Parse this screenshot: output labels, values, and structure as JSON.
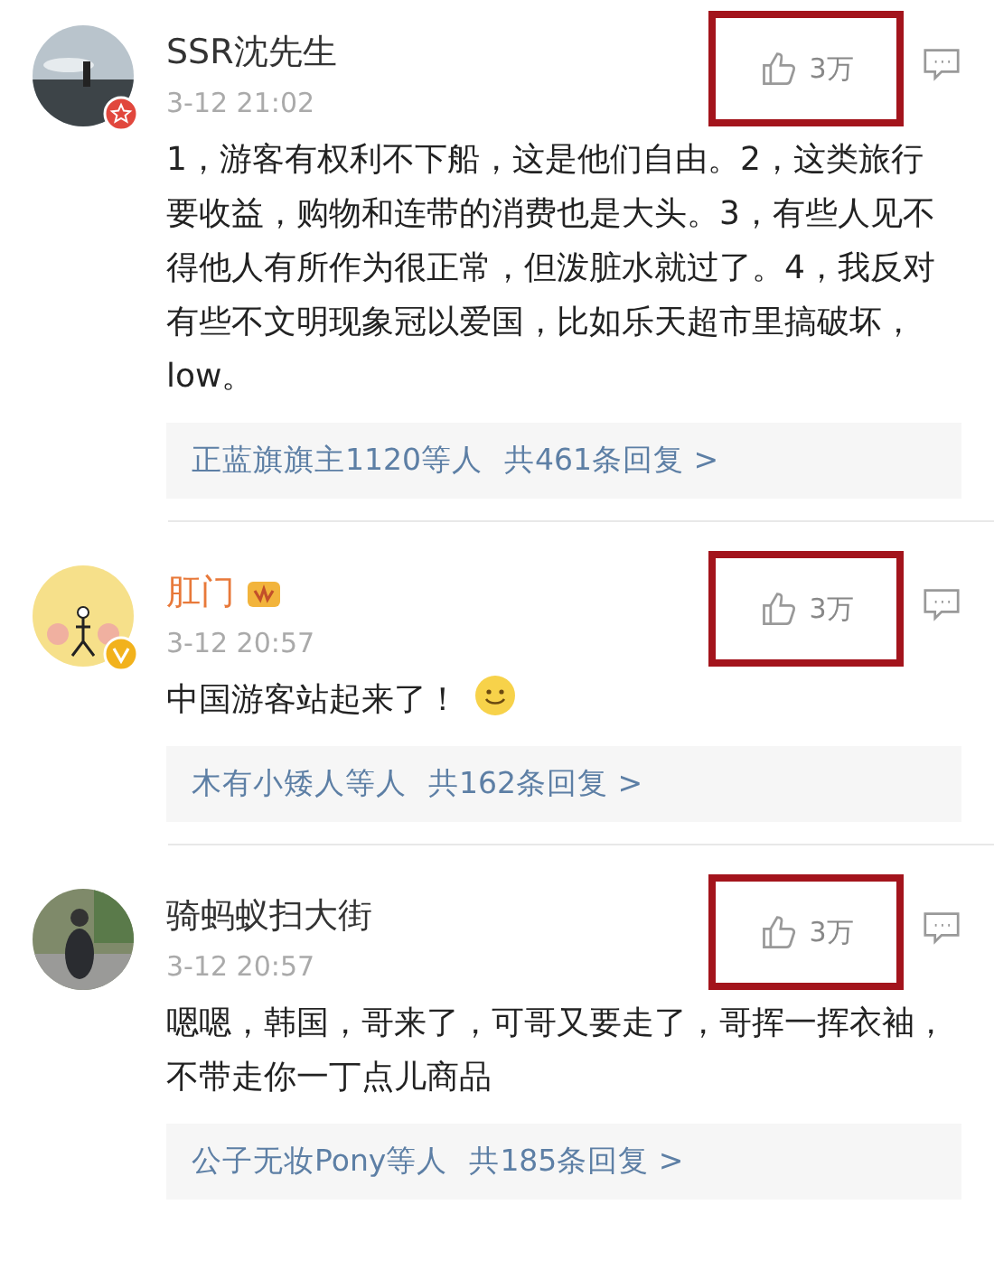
{
  "comments": [
    {
      "name": "SSR沈先生",
      "vip": false,
      "avatar": {
        "kind": "picture",
        "badge": {
          "kind": "star"
        }
      },
      "name_badge": false,
      "time": "3-12 21:02",
      "likes": "3万",
      "highlighted": true,
      "body": "1，游客有权利不下船，这是他们自由。2，这类旅行要收益，购物和连带的消费也是大头。3，有些人见不得他人有所作为很正常，但泼脏水就过了。4，我反对有些不文明现象冠以爱国，比如乐天超市里搞破坏，low。",
      "emoji": false,
      "replies": {
        "who": "正蓝旗旗主1120等人",
        "count": "共461条回复 >"
      }
    },
    {
      "name": "肛门",
      "vip": true,
      "avatar": {
        "kind": "picture",
        "badge": {
          "kind": "verified"
        }
      },
      "name_badge": true,
      "time": "3-12 20:57",
      "likes": "3万",
      "highlighted": true,
      "body": "中国游客站起来了！",
      "emoji": true,
      "replies": {
        "who": "木有小矮人等人",
        "count": "共162条回复 >"
      }
    },
    {
      "name": "骑蚂蚁扫大街",
      "vip": false,
      "name_badge": false,
      "time": "3-12 20:57",
      "likes": "3万",
      "highlighted": true,
      "body": "嗯嗯，韩国，哥来了，可哥又要走了，哥挥一挥衣袖，不带走你一丁点儿商品",
      "emoji": false,
      "replies": {
        "who": "公子无妆Pony等人",
        "count": "共185条回复 >"
      }
    }
  ]
}
